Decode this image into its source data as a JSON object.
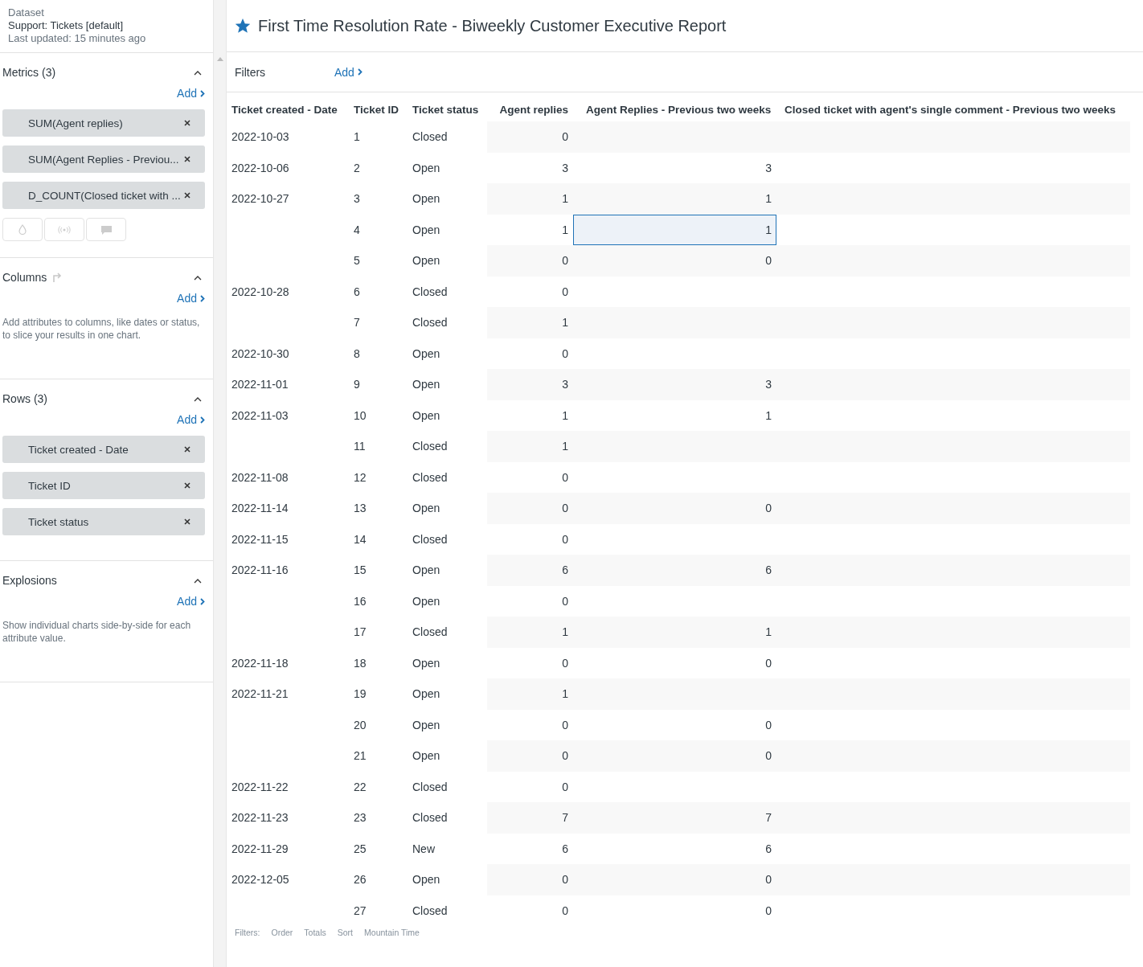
{
  "dataset": {
    "label": "Dataset",
    "name": "Support: Tickets [default]",
    "updated": "Last updated: 15 minutes ago"
  },
  "report": {
    "title": "First Time Resolution Rate - Biweekly Customer Executive Report",
    "starred": true
  },
  "sections": [
    {
      "title": "Metrics (3)",
      "kind": "metrics",
      "expanded": true,
      "add": "Add",
      "pills": [
        "SUM(Agent replies)",
        "SUM(Agent Replies - Previou...",
        "D_COUNT(Closed ticket with ..."
      ]
    },
    {
      "title": "Columns",
      "kind": "columns",
      "expanded": true,
      "add": "Add",
      "hint": "Add attributes to columns, like dates or status, to slice your results in one chart."
    },
    {
      "title": "Rows (3)",
      "kind": "rows",
      "expanded": true,
      "add": "Add",
      "pills": [
        "Ticket created - Date",
        "Ticket ID",
        "Ticket status"
      ]
    },
    {
      "title": "Explosions",
      "kind": "explosions",
      "expanded": true,
      "add": "Add",
      "hint": "Show individual charts side-by-side for each attribute value."
    }
  ],
  "filters": {
    "label": "Filters",
    "add": "Add"
  },
  "table": {
    "columns": [
      "Ticket created - Date",
      "Ticket ID",
      "Ticket status",
      "Agent replies",
      "Agent Replies - Previous two weeks",
      "Closed ticket with agent's single comment - Previous two weeks"
    ],
    "rows": [
      {
        "date": "2022-10-03",
        "id": "1",
        "status": "Closed",
        "replies": "0",
        "prev": "",
        "selected": false
      },
      {
        "date": "2022-10-06",
        "id": "2",
        "status": "Open",
        "replies": "3",
        "prev": "3",
        "selected": false
      },
      {
        "date": "2022-10-27",
        "id": "3",
        "status": "Open",
        "replies": "1",
        "prev": "1",
        "selected": false
      },
      {
        "date": "",
        "id": "4",
        "status": "Open",
        "replies": "1",
        "prev": "1",
        "selected": true
      },
      {
        "date": "",
        "id": "5",
        "status": "Open",
        "replies": "0",
        "prev": "0",
        "selected": false
      },
      {
        "date": "2022-10-28",
        "id": "6",
        "status": "Closed",
        "replies": "0",
        "prev": "",
        "selected": false
      },
      {
        "date": "",
        "id": "7",
        "status": "Closed",
        "replies": "1",
        "prev": "",
        "selected": false
      },
      {
        "date": "2022-10-30",
        "id": "8",
        "status": "Open",
        "replies": "0",
        "prev": "",
        "selected": false
      },
      {
        "date": "2022-11-01",
        "id": "9",
        "status": "Open",
        "replies": "3",
        "prev": "3",
        "selected": false
      },
      {
        "date": "2022-11-03",
        "id": "10",
        "status": "Open",
        "replies": "1",
        "prev": "1",
        "selected": false
      },
      {
        "date": "",
        "id": "11",
        "status": "Closed",
        "replies": "1",
        "prev": "",
        "selected": false
      },
      {
        "date": "2022-11-08",
        "id": "12",
        "status": "Closed",
        "replies": "0",
        "prev": "",
        "selected": false
      },
      {
        "date": "2022-11-14",
        "id": "13",
        "status": "Open",
        "replies": "0",
        "prev": "0",
        "selected": false
      },
      {
        "date": "2022-11-15",
        "id": "14",
        "status": "Closed",
        "replies": "0",
        "prev": "",
        "selected": false
      },
      {
        "date": "2022-11-16",
        "id": "15",
        "status": "Open",
        "replies": "6",
        "prev": "6",
        "selected": false
      },
      {
        "date": "",
        "id": "16",
        "status": "Open",
        "replies": "0",
        "prev": "",
        "selected": false
      },
      {
        "date": "",
        "id": "17",
        "status": "Closed",
        "replies": "1",
        "prev": "1",
        "selected": false
      },
      {
        "date": "2022-11-18",
        "id": "18",
        "status": "Open",
        "replies": "0",
        "prev": "0",
        "selected": false
      },
      {
        "date": "2022-11-21",
        "id": "19",
        "status": "Open",
        "replies": "1",
        "prev": "",
        "selected": false
      },
      {
        "date": "",
        "id": "20",
        "status": "Open",
        "replies": "0",
        "prev": "0",
        "selected": false
      },
      {
        "date": "",
        "id": "21",
        "status": "Open",
        "replies": "0",
        "prev": "0",
        "selected": false
      },
      {
        "date": "2022-11-22",
        "id": "22",
        "status": "Closed",
        "replies": "0",
        "prev": "",
        "selected": false
      },
      {
        "date": "2022-11-23",
        "id": "23",
        "status": "Closed",
        "replies": "7",
        "prev": "7",
        "selected": false
      },
      {
        "date": "2022-11-29",
        "id": "25",
        "status": "New",
        "replies": "6",
        "prev": "6",
        "selected": false
      },
      {
        "date": "2022-12-05",
        "id": "26",
        "status": "Open",
        "replies": "0",
        "prev": "0",
        "selected": false
      },
      {
        "date": "",
        "id": "27",
        "status": "Closed",
        "replies": "0",
        "prev": "0",
        "selected": false
      }
    ]
  },
  "footer": [
    "Filters:",
    "Order",
    "Totals",
    "Sort",
    "Mountain Time"
  ]
}
